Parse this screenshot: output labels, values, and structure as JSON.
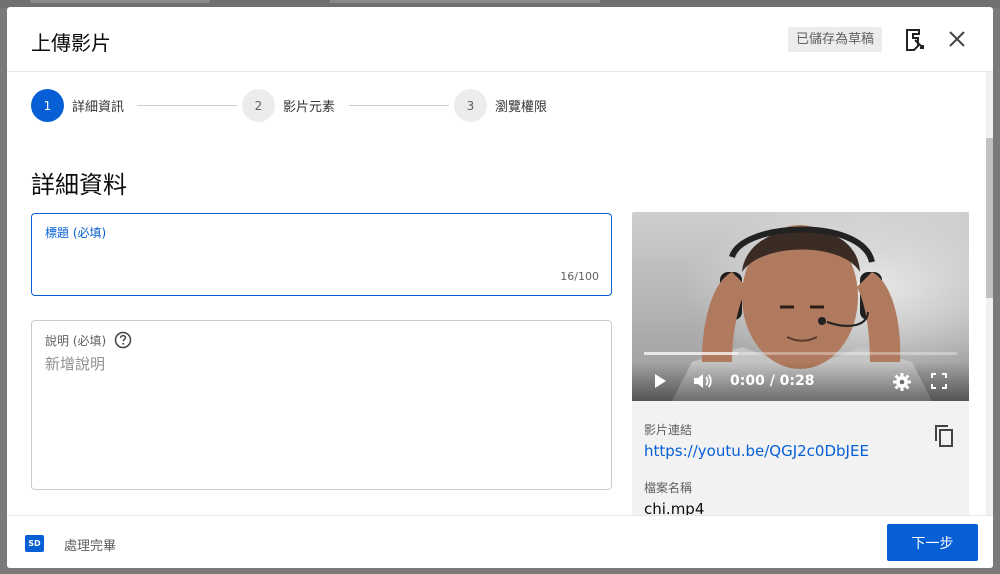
{
  "dialog": {
    "title": "上傳影片",
    "save_status": "已儲存為草稿"
  },
  "stepper": {
    "steps": [
      {
        "number": "1",
        "label": "詳細資訊",
        "active": true
      },
      {
        "number": "2",
        "label": "影片元素",
        "active": false
      },
      {
        "number": "3",
        "label": "瀏覽權限",
        "active": false
      }
    ]
  },
  "details": {
    "section_title": "詳細資料",
    "title_field": {
      "label": "標題 (必填)",
      "value": "",
      "char_count": "16/100"
    },
    "description_field": {
      "label": "說明 (必填)",
      "placeholder": "新增說明"
    }
  },
  "video_panel": {
    "time_display": "0:00 / 0:28",
    "buffered_fraction": 0.3,
    "link_label": "影片連結",
    "link_url": "https://youtu.be/QGJ2c0DbJEE",
    "filename_label": "檔案名稱",
    "filename": "chi.mp4"
  },
  "footer": {
    "quality_badge": "SD",
    "processing_status": "處理完畢",
    "next_button": "下一步"
  },
  "colors": {
    "accent": "#065fd4",
    "overlay": "#7a7a7a"
  },
  "icons": [
    "feedback-icon",
    "close-icon",
    "help-icon",
    "play-icon",
    "volume-icon",
    "settings-icon",
    "fullscreen-icon",
    "copy-icon"
  ]
}
